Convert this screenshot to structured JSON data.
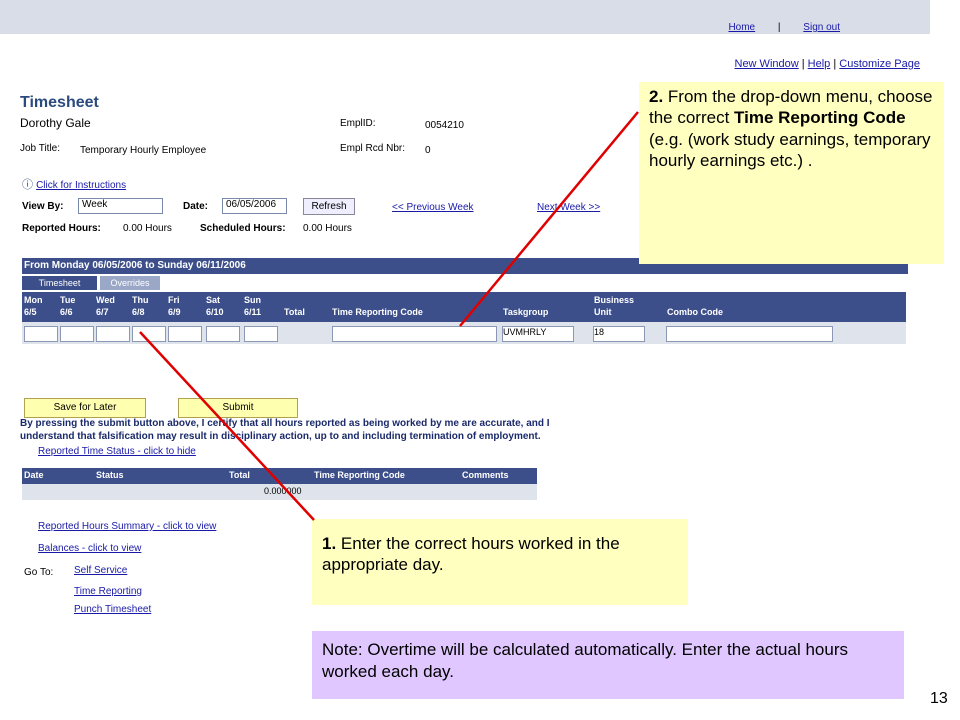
{
  "top": {
    "home": "Home",
    "signout": "Sign out"
  },
  "sub": {
    "newwindow": "New Window",
    "help": "Help",
    "customize": "Customize Page"
  },
  "page_title": "Timesheet",
  "employee": {
    "name": "Dorothy Gale",
    "empid_label": "EmplID:",
    "empid": "0054210",
    "jobtitle_label": "Job Title:",
    "jobtitle": "Temporary Hourly Employee",
    "emplrcd_label": "Empl Rcd Nbr:",
    "emplrcd": "0"
  },
  "instructions": "Click for Instructions",
  "viewby": {
    "label": "View By:",
    "value": "Week",
    "date_label": "Date:",
    "date": "06/05/2006",
    "refresh": "Refresh",
    "prev": "<< Previous Week",
    "next": "Next Week >>"
  },
  "hours": {
    "reported_label": "Reported Hours:",
    "reported": "0.00 Hours",
    "scheduled_label": "Scheduled Hours:",
    "scheduled": "0.00 Hours"
  },
  "period": "From Monday 06/05/2006 to Sunday 06/11/2006",
  "tabs": {
    "timesheet": "Timesheet",
    "overrides": "Overrides"
  },
  "columns": {
    "mon": "Mon",
    "mon_d": "6/5",
    "tue": "Tue",
    "tue_d": "6/6",
    "wed": "Wed",
    "wed_d": "6/7",
    "thu": "Thu",
    "thu_d": "6/8",
    "fri": "Fri",
    "fri_d": "6/9",
    "sat": "Sat",
    "sat_d": "6/10",
    "sun": "Sun",
    "sun_d": "6/11",
    "total": "Total",
    "trc": "Time Reporting Code",
    "taskgroup": "Taskgroup",
    "bu1": "Business",
    "bu2": "Unit",
    "combo": "Combo Code"
  },
  "row": {
    "taskgroup": "UVMHRLY",
    "bu": "18"
  },
  "buttons": {
    "save": "Save for Later",
    "submit": "Submit"
  },
  "certify1": "By pressing the submit button above, I certify that all hours reported as being worked by me are accurate, and I",
  "certify2": "understand that falsification may result in disciplinary action, up to and including termination of employment.",
  "status_link": "Reported Time Status - click to hide",
  "status_cols": {
    "date": "Date",
    "status": "Status",
    "total": "Total",
    "trc": "Time Reporting Code",
    "comments": "Comments"
  },
  "status_total": "0.000000",
  "summary_link": "Reported Hours Summary - click to view",
  "balances_link": "Balances - click to view",
  "goto": {
    "label": "Go To:",
    "l1": "Self Service",
    "l2": "Time Reporting",
    "l3": "Punch Timesheet"
  },
  "callout1": {
    "num": "1.",
    "text": "Enter the correct hours worked in the appropriate day."
  },
  "callout2": {
    "num": "2.",
    "text": "From the drop-down menu, choose the correct",
    "bold": "Time Reporting Code",
    "rest": "(e.g. (work study earnings, temporary hourly earnings etc.) ."
  },
  "note": "Note: Overtime will be calculated automatically. Enter the actual hours worked each day.",
  "page_number": "13"
}
